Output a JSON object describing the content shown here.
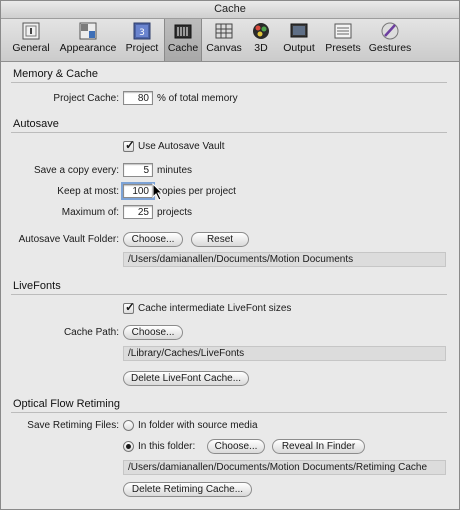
{
  "window": {
    "title": "Cache"
  },
  "toolbar": {
    "items": [
      {
        "label": "General",
        "icon": "general-icon"
      },
      {
        "label": "Appearance",
        "icon": "appearance-icon"
      },
      {
        "label": "Project",
        "icon": "project-icon"
      },
      {
        "label": "Cache",
        "icon": "cache-icon"
      },
      {
        "label": "Canvas",
        "icon": "canvas-icon"
      },
      {
        "label": "3D",
        "icon": "3d-icon"
      },
      {
        "label": "Output",
        "icon": "output-icon"
      },
      {
        "label": "Presets",
        "icon": "presets-icon"
      },
      {
        "label": "Gestures",
        "icon": "gestures-icon"
      }
    ],
    "active": "Cache"
  },
  "memory": {
    "heading": "Memory & Cache",
    "project_cache_label": "Project Cache:",
    "project_cache_value": "80",
    "project_cache_unit": "% of total memory"
  },
  "autosave": {
    "heading": "Autosave",
    "use_vault_label": "Use Autosave Vault",
    "use_vault_checked": true,
    "save_copy_label": "Save a copy every:",
    "save_copy_value": "5",
    "save_copy_unit": "minutes",
    "keep_label": "Keep at most:",
    "keep_value": "100",
    "keep_unit": "copies per project",
    "max_label": "Maximum of:",
    "max_value": "25",
    "max_unit": "projects",
    "vault_folder_label": "Autosave Vault Folder:",
    "choose_label": "Choose...",
    "reset_label": "Reset",
    "vault_path": "/Users/damianallen/Documents/Motion Documents"
  },
  "livefonts": {
    "heading": "LiveFonts",
    "cache_sizes_label": "Cache intermediate LiveFont sizes",
    "cache_sizes_checked": true,
    "cache_path_label": "Cache Path:",
    "choose_label": "Choose...",
    "path": "/Library/Caches/LiveFonts",
    "delete_label": "Delete LiveFont Cache..."
  },
  "optical": {
    "heading": "Optical Flow Retiming",
    "save_files_label": "Save Retiming Files:",
    "opt_source_label": "In folder with source media",
    "opt_folder_label": "In this folder:",
    "selected": "In this folder:",
    "choose_label": "Choose...",
    "reveal_label": "Reveal In Finder",
    "path": "/Users/damianallen/Documents/Motion Documents/Retiming Cache",
    "delete_label": "Delete Retiming Cache..."
  }
}
